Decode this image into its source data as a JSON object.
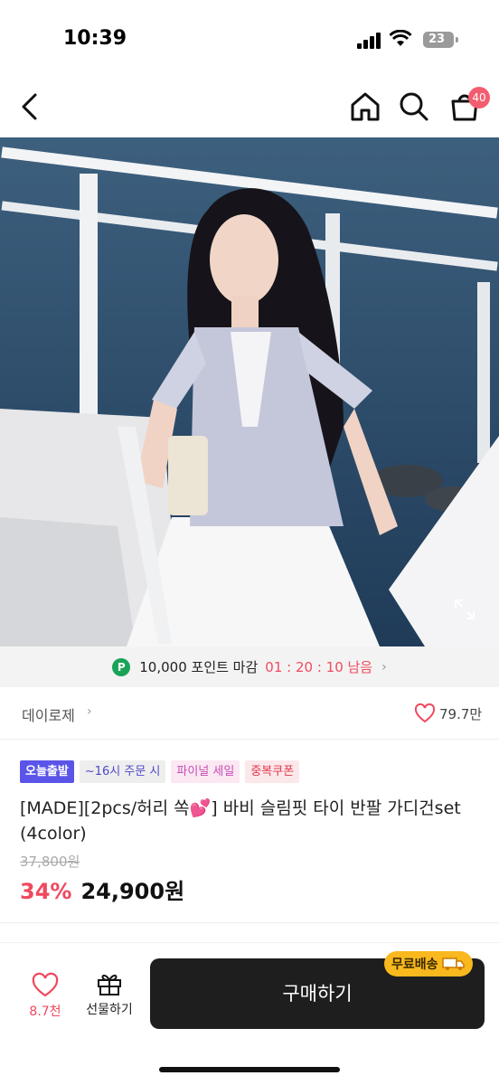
{
  "status_bar": {
    "time": "10:39",
    "battery": "23"
  },
  "nav": {
    "cart_count": "40"
  },
  "colors": {
    "accent_red": "#f0485e",
    "buy_button": "#1e1e1e",
    "point_green": "#19a356",
    "free_ship": "#f9b81d"
  },
  "point_banner": {
    "badge": "P",
    "text": "10,000 포인트 마감",
    "timer": "01 : 20 : 10 남음",
    "arrow": "›"
  },
  "store": {
    "name": "데이로제",
    "chevron": "›",
    "likes": "79.7만"
  },
  "badges": {
    "today": "오늘출발",
    "time": "~16시 주문 시",
    "final_sale": "파이널 세일",
    "coupon": "중복쿠폰"
  },
  "product": {
    "title": "[MADE][2pcs/허리 쏙💕] 바비 슬림핏 타이 반팔 가디건set (4color)",
    "original_price": "37,800원",
    "discount": "34%",
    "price": "24,900원"
  },
  "bottom_bar": {
    "wish_count": "8.7천",
    "gift_label": "선물하기",
    "buy_label": "구매하기",
    "free_ship": "무료배송"
  }
}
